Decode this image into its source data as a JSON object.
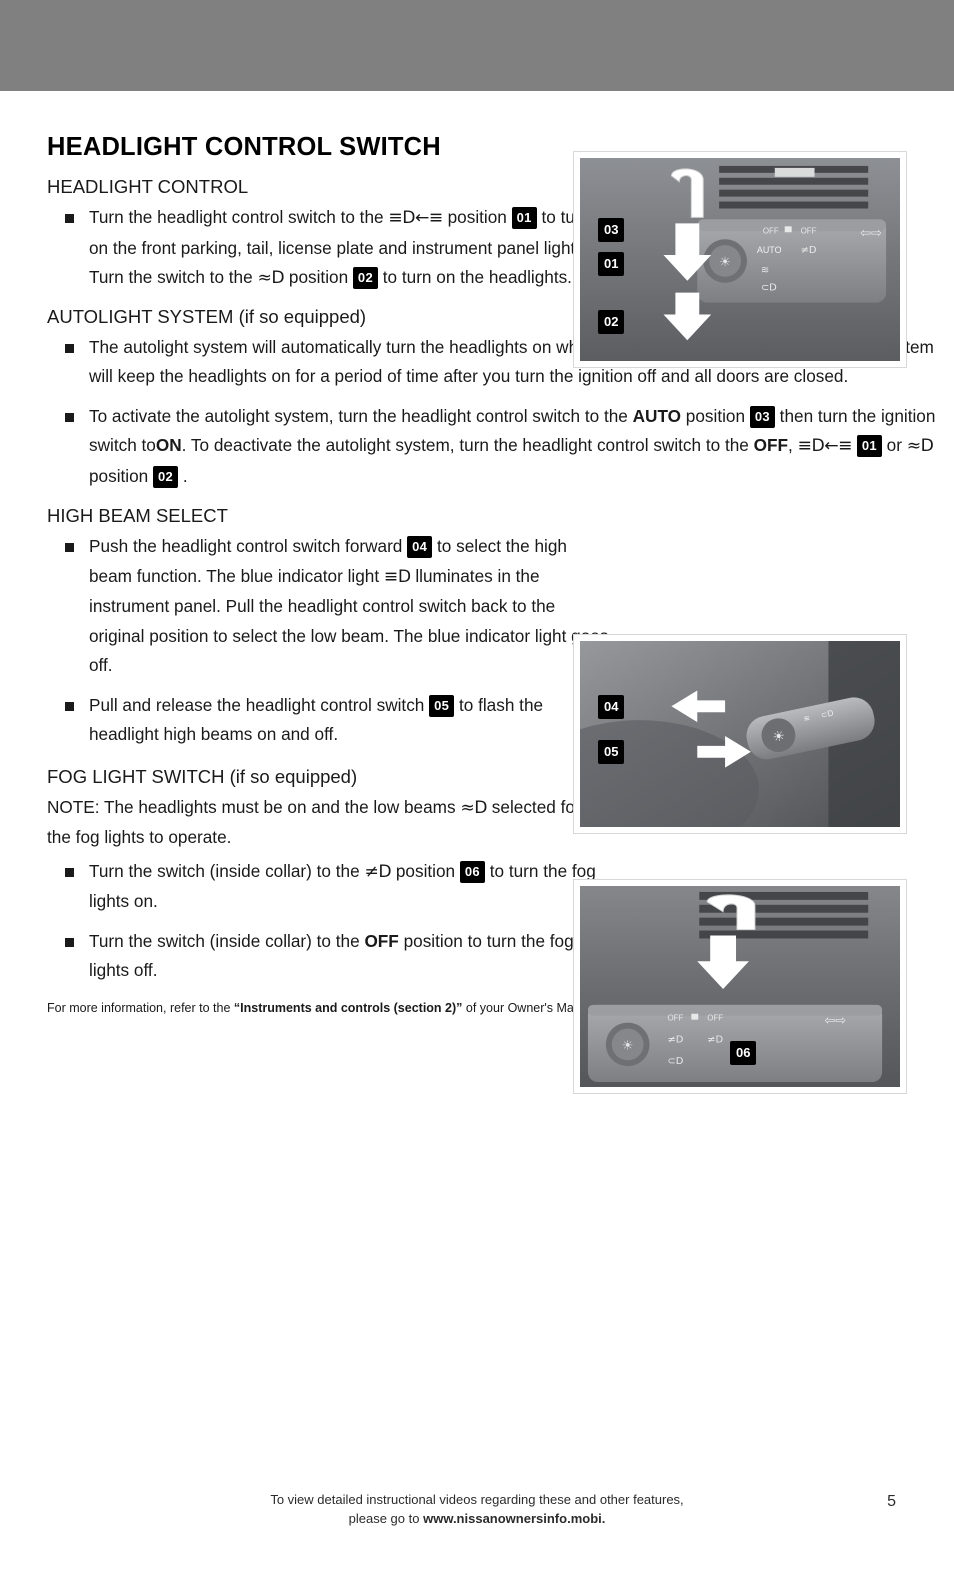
{
  "document": {
    "title": "HEADLIGHT CONTROL SWITCH",
    "page_number": "5"
  },
  "sections": {
    "headlight_control": {
      "heading": "HEADLIGHT CONTROL",
      "bullet_1": {
        "part_1": "Turn the headlight control switch to the",
        "symbol_1": "≡D←≡",
        "part_2": "position",
        "badge_1": "01",
        "part_3": "to turn on the front parking, tail, license plate and instrument panel lights. Turn the switch to the",
        "symbol_2": "≈D",
        "part_4": "position",
        "badge_2": "02",
        "part_5": "to turn on the headlights."
      }
    },
    "autolight": {
      "heading": "AUTOLIGHT SYSTEM",
      "heading_suffix": "(if so equipped)",
      "bullet_1": "The autolight system will automatically turn the headlights on when it is dark and off when it is light. The system will keep the headlights on for a period of time after you turn the ignition off and all doors are closed.",
      "bullet_2": {
        "part_1": "To activate the autolight system, turn the headlight control switch to the",
        "bold_1": "AUTO",
        "part_2": "position",
        "badge_1": "03",
        "part_3": "then turn the ignition switch to",
        "bold_2": "ON",
        "part_4": ". To deactivate the autolight system, turn the headlight control switch to the",
        "bold_3": "OFF",
        "part_5": ",",
        "symbol_1": "≡D←≡",
        "badge_2": "01",
        "part_6": "or",
        "symbol_2": "≈D",
        "part_7": "position",
        "badge_3": "02",
        "part_8": "."
      }
    },
    "high_beam": {
      "heading": "HIGH BEAM SELECT",
      "bullet_1": {
        "part_1": "Push the headlight control switch forward",
        "badge_1": "04",
        "part_2": "to select the high beam function. The blue indicator light",
        "symbol_1": "≡D",
        "part_3": "lluminates in the instrument panel. Pull the headlight control switch back to the original position to select the low beam. The blue indicator light goes off."
      },
      "bullet_2": {
        "part_1": "Pull and release the headlight control switch",
        "badge_1": "05",
        "part_2": "to flash the headlight high beams on and off."
      }
    },
    "fog_light": {
      "heading": "FOG LIGHT SWITCH",
      "heading_suffix": "(if so equipped)",
      "note": {
        "part_1": "NOTE: The headlights must be on and the low beams",
        "symbol_1": "≈D",
        "part_2": "selected for the fog lights to operate."
      },
      "bullet_1": {
        "part_1": "Turn the switch (inside collar) to the",
        "symbol_1": "≠D",
        "part_2": "position",
        "badge_1": "06",
        "part_3": "to turn the fog lights on."
      },
      "bullet_2": {
        "part_1": "Turn the switch (inside collar) to the",
        "bold_1": "OFF",
        "part_2": "position to turn the fog lights off."
      }
    }
  },
  "footnote": {
    "part_1": "For more information, refer to the",
    "bold_1": "“Instruments and controls (section 2)”",
    "part_2": "of your Owner's Manual."
  },
  "photos": {
    "photo_1": {
      "name": "headlight-control-switch-photo",
      "callouts": [
        "03",
        "01",
        "02"
      ],
      "labels": [
        "OFF",
        "OFF",
        "AUTO"
      ]
    },
    "photo_2": {
      "name": "high-beam-stalk-photo",
      "callouts": [
        "04",
        "05"
      ]
    },
    "photo_3": {
      "name": "fog-light-switch-photo",
      "callouts": [
        "06"
      ],
      "labels": [
        "OFF",
        "OFF"
      ]
    }
  },
  "footer": {
    "line_1": "To view detailed instructional videos regarding these and other features,",
    "line_2_prefix": "please go to",
    "line_2_bold": "www.nissanownersinfo.mobi."
  }
}
